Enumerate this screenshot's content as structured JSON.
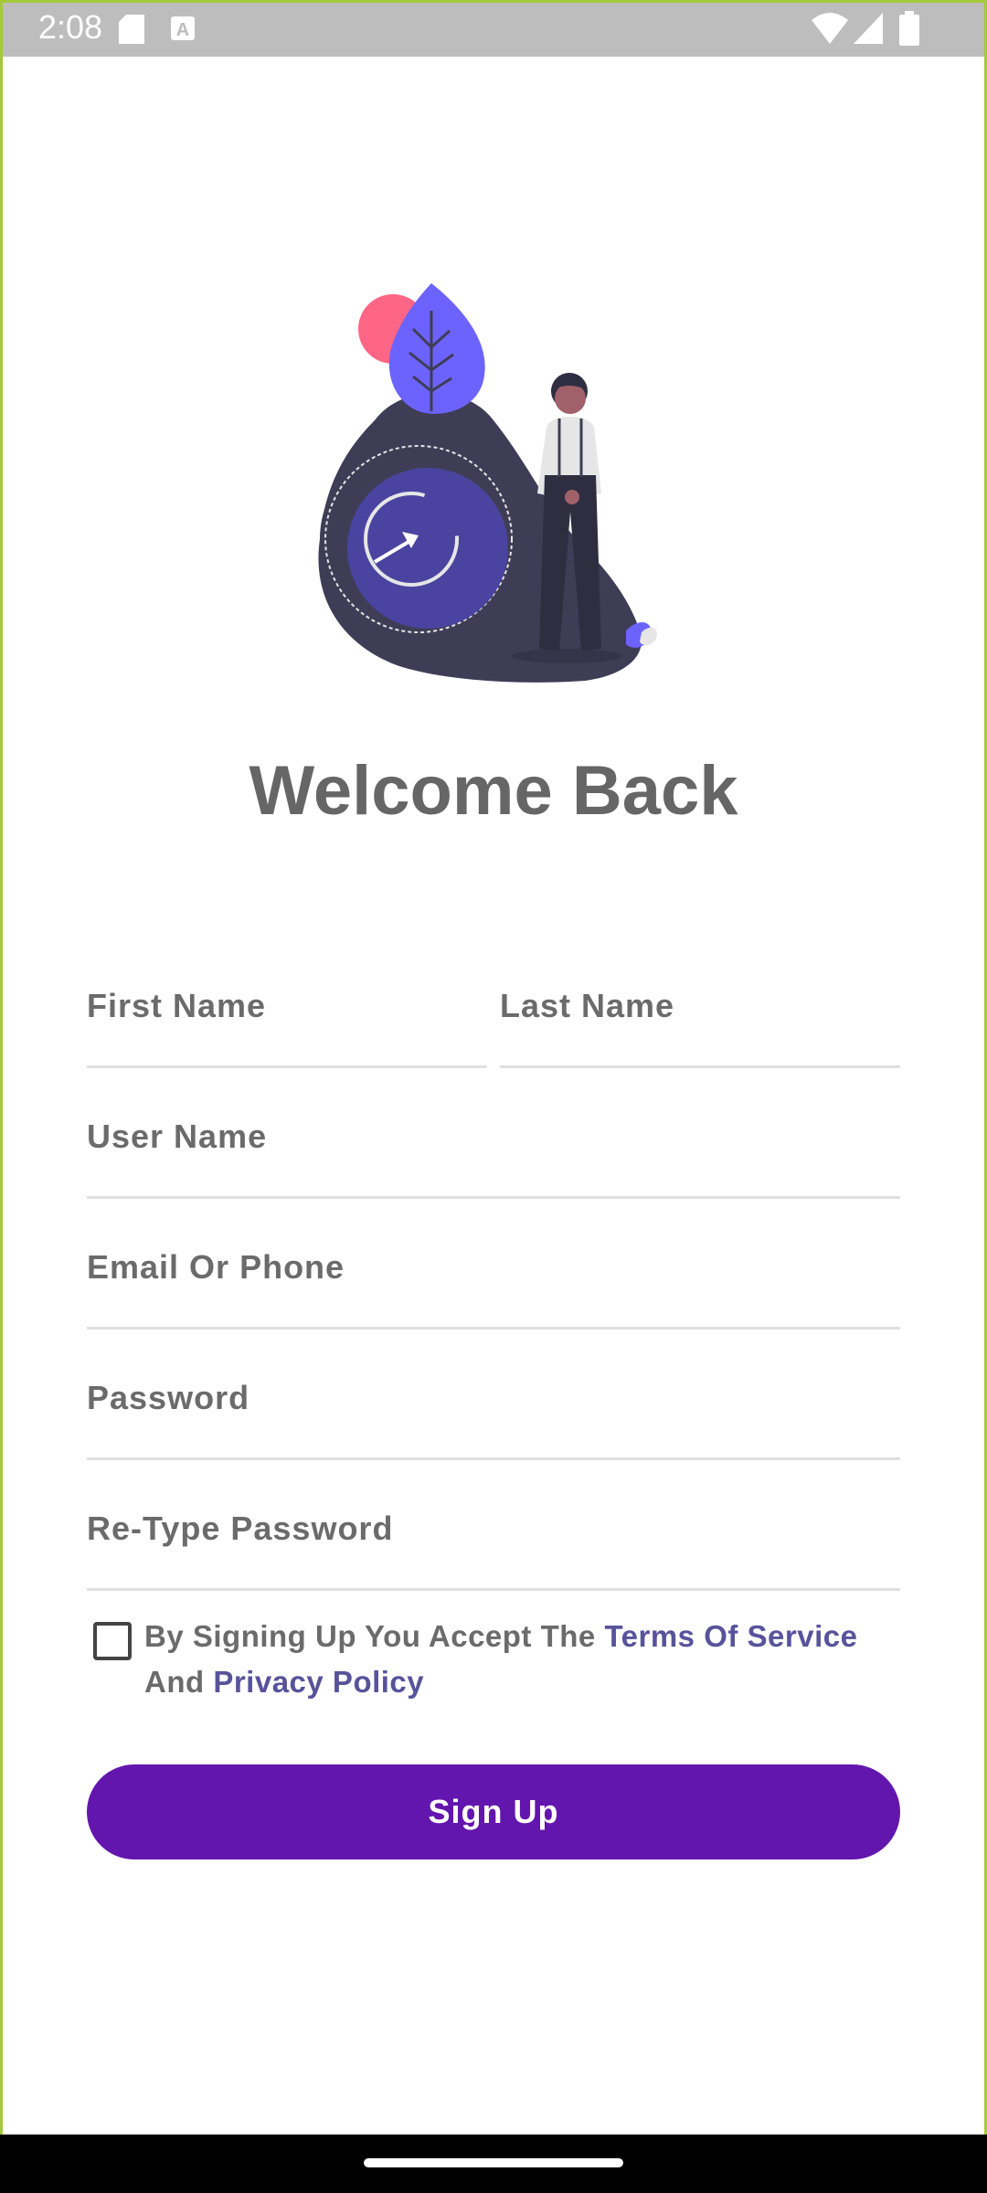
{
  "status_bar": {
    "time": "2:08",
    "icons": [
      "sd-card-icon",
      "a-notification-icon",
      "wifi-icon",
      "signal-icon",
      "battery-icon"
    ]
  },
  "welcome": {
    "title": "Welcome Back"
  },
  "form": {
    "first_name": {
      "placeholder": "First Name"
    },
    "last_name": {
      "placeholder": "Last Name"
    },
    "user_name": {
      "placeholder": "User Name"
    },
    "email_phone": {
      "placeholder": "Email Or Phone"
    },
    "password": {
      "placeholder": "Password"
    },
    "retype_password": {
      "placeholder": "Re-Type Password"
    }
  },
  "terms": {
    "prefix": "By Signing Up You Accept The ",
    "terms_link": "Terms Of Service",
    "middle": " And ",
    "privacy_link": "Privacy Policy",
    "checked": false
  },
  "signup_button": {
    "label": "Sign Up"
  },
  "colors": {
    "accent": "#6316ad",
    "link": "#58539a",
    "text": "#6b6b6b",
    "frame": "#a4c93a"
  }
}
